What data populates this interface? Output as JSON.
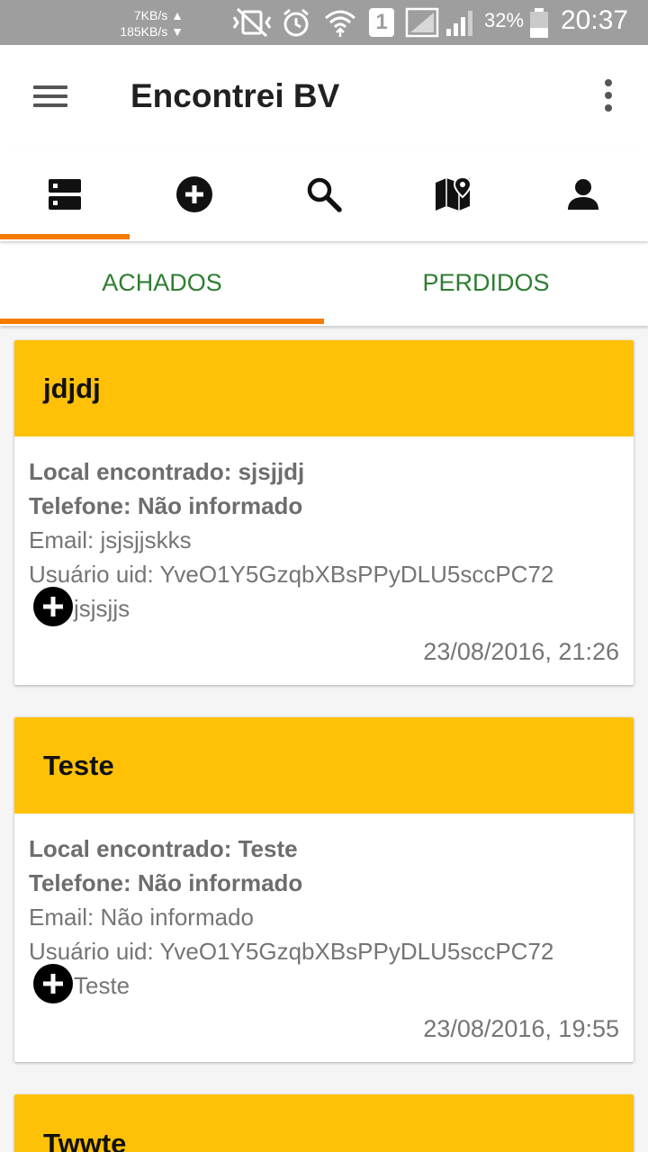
{
  "status_bar": {
    "speed_up": "7KB/s ▲",
    "speed_down": "185KB/s ▼",
    "sim_slot": "1",
    "battery": "32%",
    "time": "20:37"
  },
  "app_bar": {
    "title": "Encontrei BV"
  },
  "icon_tabs": [
    {
      "icon": "list-icon",
      "selected": true
    },
    {
      "icon": "add-circle-icon",
      "selected": false
    },
    {
      "icon": "search-icon",
      "selected": false
    },
    {
      "icon": "map-icon",
      "selected": false
    },
    {
      "icon": "person-icon",
      "selected": false
    }
  ],
  "sub_tabs": [
    {
      "label": "ACHADOS",
      "selected": true
    },
    {
      "label": "PERDIDOS",
      "selected": false
    }
  ],
  "colors": {
    "accent": "#f57c00",
    "card_header": "#ffc107",
    "tab_text": "#2e7d32"
  },
  "items": [
    {
      "title": "jdjdj",
      "local": "Local encontrado: sjsjjdj",
      "phone": "Telefone: Não informado",
      "email": "Email: jsjsjjskks",
      "uid": "Usuário uid: YveO1Y5GzqbXBsPPyDLU5sccPC72",
      "description": "jsjsjjs",
      "date": "23/08/2016, 21:26"
    },
    {
      "title": "Teste",
      "local": "Local encontrado: Teste",
      "phone": "Telefone: Não informado",
      "email": "Email: Não informado",
      "uid": "Usuário uid: YveO1Y5GzqbXBsPPyDLU5sccPC72",
      "description": "Teste",
      "date": "23/08/2016, 19:55"
    },
    {
      "title": "Twwte"
    }
  ]
}
